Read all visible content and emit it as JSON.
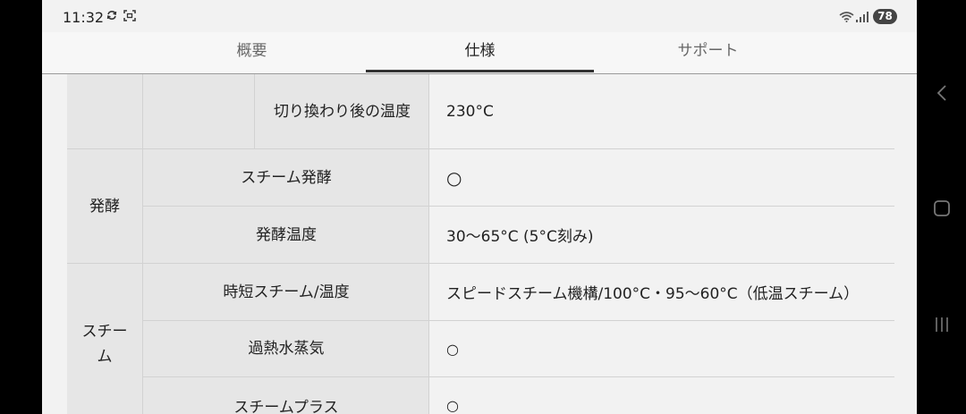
{
  "status_bar": {
    "time": "11:32",
    "battery": "78",
    "icons": [
      "sync-icon",
      "screenshot-icon",
      "wifi-icon",
      "signal-icon"
    ]
  },
  "tabs": [
    {
      "label": "概要",
      "active": false
    },
    {
      "label": "仕様",
      "active": true
    },
    {
      "label": "サポート",
      "active": false
    }
  ],
  "spec_table": {
    "rows": [
      {
        "label": "切り換わり後の温度",
        "value": "230°C"
      },
      {
        "category": "発酵",
        "label": "スチーム発酵",
        "value": "○"
      },
      {
        "label": "発酵温度",
        "value": "30～65°C (5°C刻み)"
      },
      {
        "category": "スチーム",
        "label": "時短スチーム/温度",
        "value": "スピードスチーム機構/100°C・95～60°C（低温スチーム）"
      },
      {
        "label": "過熱水蒸気",
        "value": "○"
      },
      {
        "label": "スチームプラス",
        "value": "○"
      }
    ]
  },
  "nav_bar": {
    "icons": [
      "back-icon",
      "home-icon",
      "recents-icon"
    ]
  }
}
